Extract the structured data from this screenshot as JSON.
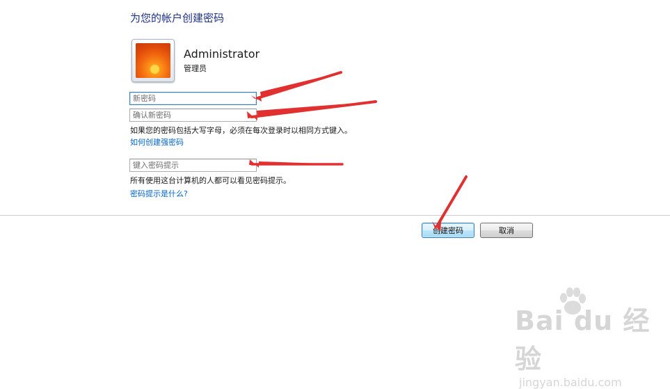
{
  "header": {
    "title": "为您的帐户创建密码"
  },
  "account": {
    "name": "Administrator",
    "role": "管理员",
    "avatar_icon": "flower-avatar-icon"
  },
  "form": {
    "new_password_placeholder": "新密码",
    "confirm_password_placeholder": "确认新密码",
    "case_hint": "如果您的密码包括大写字母，必须在每次登录时以相同方式键入。",
    "strong_password_link": "如何创建强密码",
    "hint_placeholder": "键入密码提示",
    "hint_visibility_note": "所有使用这台计算机的人都可以看见密码提示。",
    "hint_help_link": "密码提示是什么?"
  },
  "buttons": {
    "create": "创建密码",
    "cancel": "取消"
  },
  "watermark": {
    "brand": "Bai du 经验",
    "url": "jingyan.baidu.com"
  },
  "colors": {
    "title": "#1e3287",
    "link": "#0066cc",
    "arrow": "#e03030"
  }
}
